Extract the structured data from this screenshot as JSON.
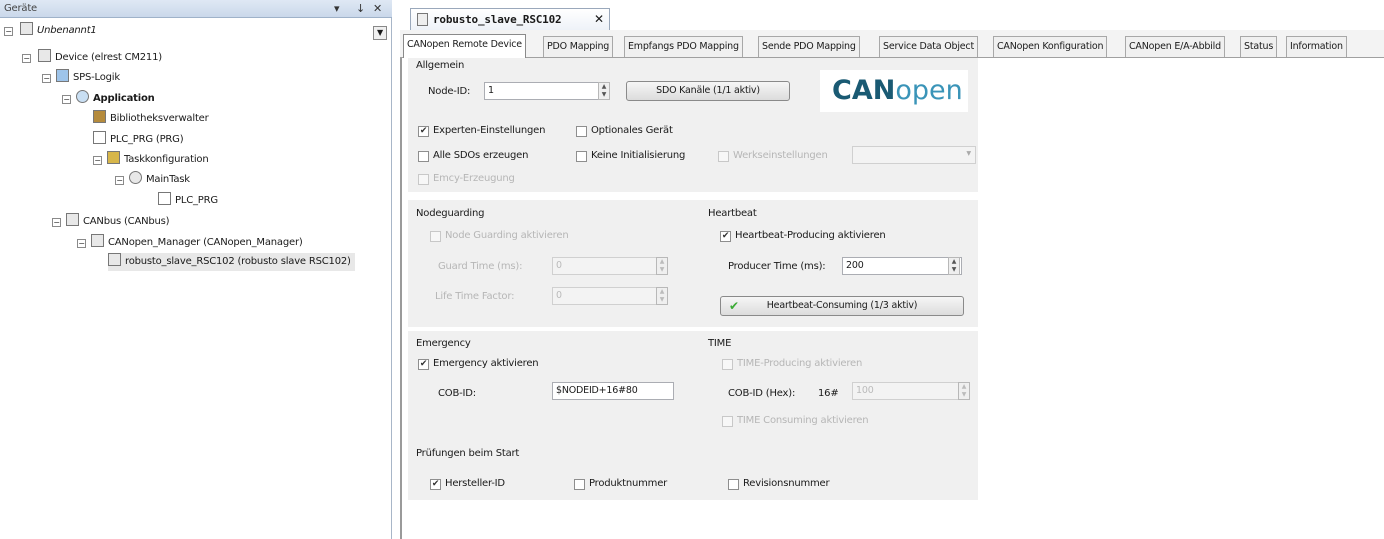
{
  "left_panel": {
    "title": "Geräte",
    "pin": "▾",
    "pin2": "↓",
    "close": "✕",
    "tree": [
      {
        "label": "Unbenannt1",
        "exp": "−"
      },
      {
        "label": "Device (elrest CM211)",
        "exp": "−"
      },
      {
        "label": "SPS-Logik",
        "exp": "−"
      },
      {
        "label": "Application",
        "exp": "−"
      },
      {
        "label": "Bibliotheksverwalter"
      },
      {
        "label": "PLC_PRG (PRG)"
      },
      {
        "label": "Taskkonfiguration",
        "exp": "−"
      },
      {
        "label": "MainTask",
        "exp": "−"
      },
      {
        "label": "PLC_PRG"
      },
      {
        "label": "CANbus (CANbus)",
        "exp": "−"
      },
      {
        "label": "CANopen_Manager (CANopen_Manager)",
        "exp": "−"
      },
      {
        "label": "robusto_slave_RSC102 (robusto slave RSC102)"
      }
    ]
  },
  "doc_tab": {
    "title": "robusto_slave_RSC102",
    "close": "✕"
  },
  "tabs": [
    "CANopen Remote Device",
    "PDO Mapping",
    "Empfangs PDO Mapping",
    "Sende PDO Mapping",
    "Service Data Object",
    "CANopen Konfiguration",
    "CANopen E/A-Abbild",
    "Status",
    "Information"
  ],
  "general": {
    "heading": "Allgemein",
    "node_id_label": "Node-ID:",
    "node_id_value": "1",
    "sdo_button": "SDO Kanäle (1/1 aktiv)",
    "logo_bold": "CAN",
    "logo_light": "open",
    "expert": "Experten-Einstellungen",
    "optional": "Optionales Gerät",
    "all_sdos": "Alle SDOs erzeugen",
    "no_init": "Keine Initialisierung",
    "factory": "Werkseinstellungen",
    "emcy_gen": "Emcy-Erzeugung"
  },
  "nodeguarding": {
    "heading": "Nodeguarding",
    "enable": "Node Guarding aktivieren",
    "guard_label": "Guard Time (ms):",
    "guard_value": "0",
    "life_label": "Life Time Factor:",
    "life_value": "0"
  },
  "heartbeat": {
    "heading": "Heartbeat",
    "enable": "Heartbeat-Producing aktivieren",
    "producer_label": "Producer Time (ms):",
    "producer_value": "200",
    "consuming_button": "Heartbeat-Consuming (1/3 aktiv)",
    "check": "✔"
  },
  "emergency": {
    "heading": "Emergency",
    "enable": "Emergency aktivieren",
    "cob_label": "COB-ID:",
    "cob_value": "$NODEID+16#80"
  },
  "time": {
    "heading": "TIME",
    "producing": "TIME-Producing aktivieren",
    "cob_label": "COB-ID (Hex):",
    "prefix": "16#",
    "cob_value": "100",
    "consuming": "TIME Consuming aktivieren"
  },
  "checks": {
    "heading": "Prüfungen beim Start",
    "vendor": "Hersteller-ID",
    "product": "Produktnummer",
    "revision": "Revisionsnummer"
  },
  "colors": {
    "logo_dark": "#1a5a73",
    "logo_light": "#3a94b8",
    "check_green": "#3aaa35"
  }
}
